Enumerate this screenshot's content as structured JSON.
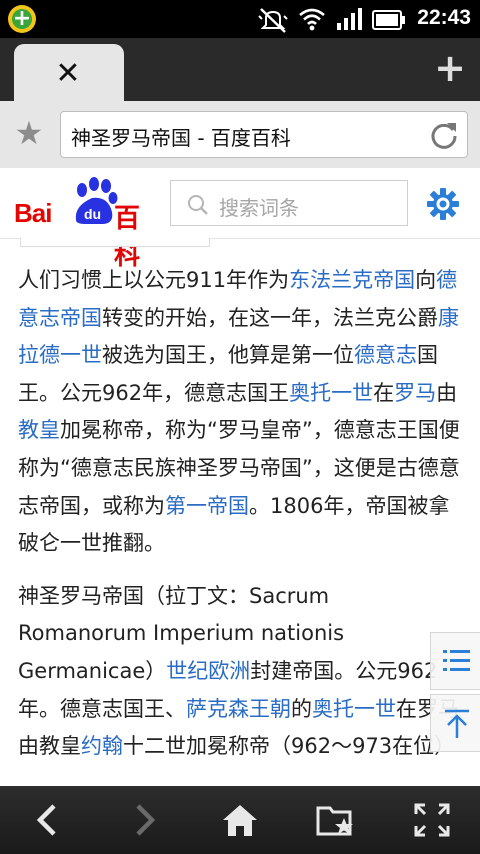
{
  "status_bar": {
    "time": "22:43",
    "icons": [
      "app-plus-icon",
      "vibrate-silent-icon",
      "wifi-icon",
      "signal-icon",
      "battery-icon"
    ]
  },
  "tabs": {
    "close_glyph": "✕",
    "new_tab_glyph": "+"
  },
  "address_bar": {
    "page_title": "神圣罗马帝国 - 百度百科",
    "bookmark_icon": "star-icon",
    "reload_icon": "reload-icon"
  },
  "baidu_header": {
    "logo_bai": "Bai",
    "logo_du": "du",
    "logo_baike": "百科",
    "search_placeholder": "搜索词条",
    "settings_icon": "gear-icon"
  },
  "colors": {
    "link": "#2a6cc5",
    "brand_red": "#e10601",
    "brand_blue": "#2932e1",
    "settings_blue": "#2b7fd6"
  },
  "article": {
    "p1": {
      "t1": "人们习惯上以公元911年作为",
      "l1": "东法兰克帝国",
      "t2": "向",
      "l2": "德意志帝国",
      "t3": "转变的开始，在这一年，法兰克公爵",
      "l3": "康拉德一世",
      "t4": "被选为国王，他算是第一位",
      "l4": "德意志",
      "t5": "国王。公元962年，德意志国王",
      "l5": "奥托一世",
      "t6": "在",
      "l6": "罗马",
      "t7": "由",
      "l7": "教皇",
      "t8": "加冕称帝，称为“罗马皇帝”，德意志王国便称为“德意志民族神圣罗马帝国”，这便是古德意志帝国，或称为",
      "l8": "第一帝国",
      "t9": "。1806年，帝国被拿破仑一世推翻。"
    },
    "p2": {
      "t1": "神圣罗马帝国（拉丁文：Sacrum Romanorum Imperium nationis Germanicae）",
      "l1": "世纪欧洲",
      "t2": "封建帝国。公元962年。德意志国王、",
      "l2": "萨克森王朝",
      "t3": "的",
      "l3": "奥托一世",
      "t4": "在罗马由教皇",
      "l4": "约翰",
      "t5": "十二世加冕称帝（962～973在位）"
    }
  },
  "floating": {
    "toc_icon": "list-icon",
    "top_icon": "back-to-top-icon"
  },
  "toolbar": {
    "items": [
      "back-arrow-icon",
      "forward-arrow-icon",
      "home-icon",
      "bookmarks-folder-icon",
      "fullscreen-icon"
    ]
  }
}
